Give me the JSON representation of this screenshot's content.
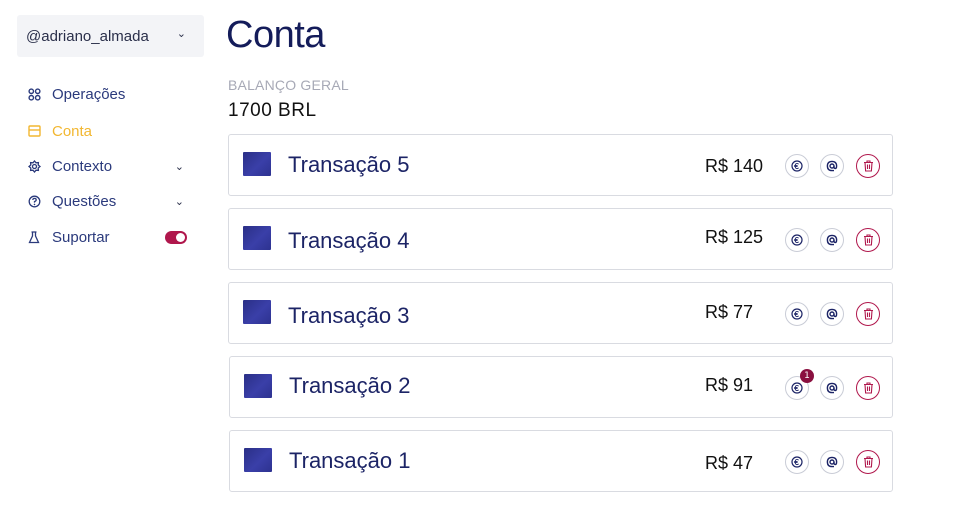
{
  "user": {
    "handle": "@adriano_almada"
  },
  "nav": {
    "items": [
      {
        "label": "Operações",
        "icon": "grid-icon",
        "active": false
      },
      {
        "label": "Conta",
        "icon": "wallet-icon",
        "active": true
      },
      {
        "label": "Contexto",
        "icon": "settings-icon",
        "active": false,
        "expandable": true
      },
      {
        "label": "Questões",
        "icon": "help-icon",
        "active": false,
        "expandable": true
      },
      {
        "label": "Suportar",
        "icon": "flask-icon",
        "active": false,
        "toggle": true
      }
    ]
  },
  "page": {
    "title": "Conta",
    "balance_label": "BALANÇO GERAL",
    "balance_value": "1700 BRL"
  },
  "transactions": [
    {
      "name": "Transação 5",
      "amount": "R$ 140",
      "badge": null
    },
    {
      "name": "Transação 4",
      "amount": "R$ 125",
      "badge": null
    },
    {
      "name": "Transação 3",
      "amount": "R$ 77",
      "badge": null
    },
    {
      "name": "Transação 2",
      "amount": "R$ 91",
      "badge": "1"
    },
    {
      "name": "Transação 1",
      "amount": "R$ 47",
      "badge": null
    }
  ],
  "colors": {
    "accent": "#f2b731",
    "primary_text": "#1c2466",
    "danger": "#b0174c",
    "badge": "#8a1040"
  }
}
